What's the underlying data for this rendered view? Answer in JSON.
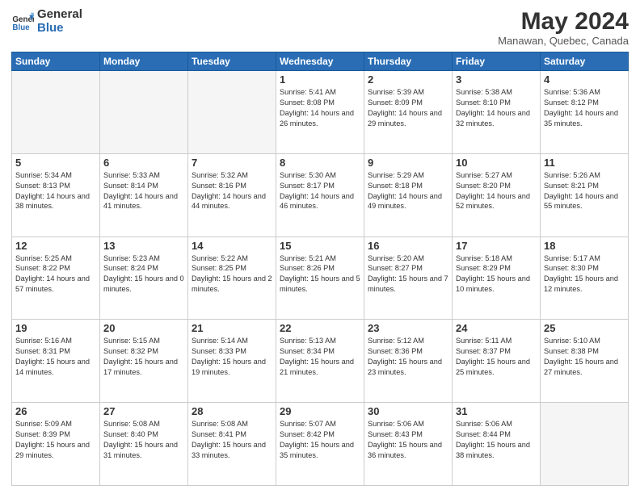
{
  "header": {
    "logo_general": "General",
    "logo_blue": "Blue",
    "month_title": "May 2024",
    "subtitle": "Manawan, Quebec, Canada"
  },
  "days_of_week": [
    "Sunday",
    "Monday",
    "Tuesday",
    "Wednesday",
    "Thursday",
    "Friday",
    "Saturday"
  ],
  "weeks": [
    [
      {
        "day": "",
        "empty": true
      },
      {
        "day": "",
        "empty": true
      },
      {
        "day": "",
        "empty": true
      },
      {
        "day": "1",
        "sunrise": "5:41 AM",
        "sunset": "8:08 PM",
        "daylight": "14 hours and 26 minutes."
      },
      {
        "day": "2",
        "sunrise": "5:39 AM",
        "sunset": "8:09 PM",
        "daylight": "14 hours and 29 minutes."
      },
      {
        "day": "3",
        "sunrise": "5:38 AM",
        "sunset": "8:10 PM",
        "daylight": "14 hours and 32 minutes."
      },
      {
        "day": "4",
        "sunrise": "5:36 AM",
        "sunset": "8:12 PM",
        "daylight": "14 hours and 35 minutes."
      }
    ],
    [
      {
        "day": "5",
        "sunrise": "5:34 AM",
        "sunset": "8:13 PM",
        "daylight": "14 hours and 38 minutes."
      },
      {
        "day": "6",
        "sunrise": "5:33 AM",
        "sunset": "8:14 PM",
        "daylight": "14 hours and 41 minutes."
      },
      {
        "day": "7",
        "sunrise": "5:32 AM",
        "sunset": "8:16 PM",
        "daylight": "14 hours and 44 minutes."
      },
      {
        "day": "8",
        "sunrise": "5:30 AM",
        "sunset": "8:17 PM",
        "daylight": "14 hours and 46 minutes."
      },
      {
        "day": "9",
        "sunrise": "5:29 AM",
        "sunset": "8:18 PM",
        "daylight": "14 hours and 49 minutes."
      },
      {
        "day": "10",
        "sunrise": "5:27 AM",
        "sunset": "8:20 PM",
        "daylight": "14 hours and 52 minutes."
      },
      {
        "day": "11",
        "sunrise": "5:26 AM",
        "sunset": "8:21 PM",
        "daylight": "14 hours and 55 minutes."
      }
    ],
    [
      {
        "day": "12",
        "sunrise": "5:25 AM",
        "sunset": "8:22 PM",
        "daylight": "14 hours and 57 minutes."
      },
      {
        "day": "13",
        "sunrise": "5:23 AM",
        "sunset": "8:24 PM",
        "daylight": "15 hours and 0 minutes."
      },
      {
        "day": "14",
        "sunrise": "5:22 AM",
        "sunset": "8:25 PM",
        "daylight": "15 hours and 2 minutes."
      },
      {
        "day": "15",
        "sunrise": "5:21 AM",
        "sunset": "8:26 PM",
        "daylight": "15 hours and 5 minutes."
      },
      {
        "day": "16",
        "sunrise": "5:20 AM",
        "sunset": "8:27 PM",
        "daylight": "15 hours and 7 minutes."
      },
      {
        "day": "17",
        "sunrise": "5:18 AM",
        "sunset": "8:29 PM",
        "daylight": "15 hours and 10 minutes."
      },
      {
        "day": "18",
        "sunrise": "5:17 AM",
        "sunset": "8:30 PM",
        "daylight": "15 hours and 12 minutes."
      }
    ],
    [
      {
        "day": "19",
        "sunrise": "5:16 AM",
        "sunset": "8:31 PM",
        "daylight": "15 hours and 14 minutes."
      },
      {
        "day": "20",
        "sunrise": "5:15 AM",
        "sunset": "8:32 PM",
        "daylight": "15 hours and 17 minutes."
      },
      {
        "day": "21",
        "sunrise": "5:14 AM",
        "sunset": "8:33 PM",
        "daylight": "15 hours and 19 minutes."
      },
      {
        "day": "22",
        "sunrise": "5:13 AM",
        "sunset": "8:34 PM",
        "daylight": "15 hours and 21 minutes."
      },
      {
        "day": "23",
        "sunrise": "5:12 AM",
        "sunset": "8:36 PM",
        "daylight": "15 hours and 23 minutes."
      },
      {
        "day": "24",
        "sunrise": "5:11 AM",
        "sunset": "8:37 PM",
        "daylight": "15 hours and 25 minutes."
      },
      {
        "day": "25",
        "sunrise": "5:10 AM",
        "sunset": "8:38 PM",
        "daylight": "15 hours and 27 minutes."
      }
    ],
    [
      {
        "day": "26",
        "sunrise": "5:09 AM",
        "sunset": "8:39 PM",
        "daylight": "15 hours and 29 minutes."
      },
      {
        "day": "27",
        "sunrise": "5:08 AM",
        "sunset": "8:40 PM",
        "daylight": "15 hours and 31 minutes."
      },
      {
        "day": "28",
        "sunrise": "5:08 AM",
        "sunset": "8:41 PM",
        "daylight": "15 hours and 33 minutes."
      },
      {
        "day": "29",
        "sunrise": "5:07 AM",
        "sunset": "8:42 PM",
        "daylight": "15 hours and 35 minutes."
      },
      {
        "day": "30",
        "sunrise": "5:06 AM",
        "sunset": "8:43 PM",
        "daylight": "15 hours and 36 minutes."
      },
      {
        "day": "31",
        "sunrise": "5:06 AM",
        "sunset": "8:44 PM",
        "daylight": "15 hours and 38 minutes."
      },
      {
        "day": "",
        "empty": true
      }
    ]
  ]
}
